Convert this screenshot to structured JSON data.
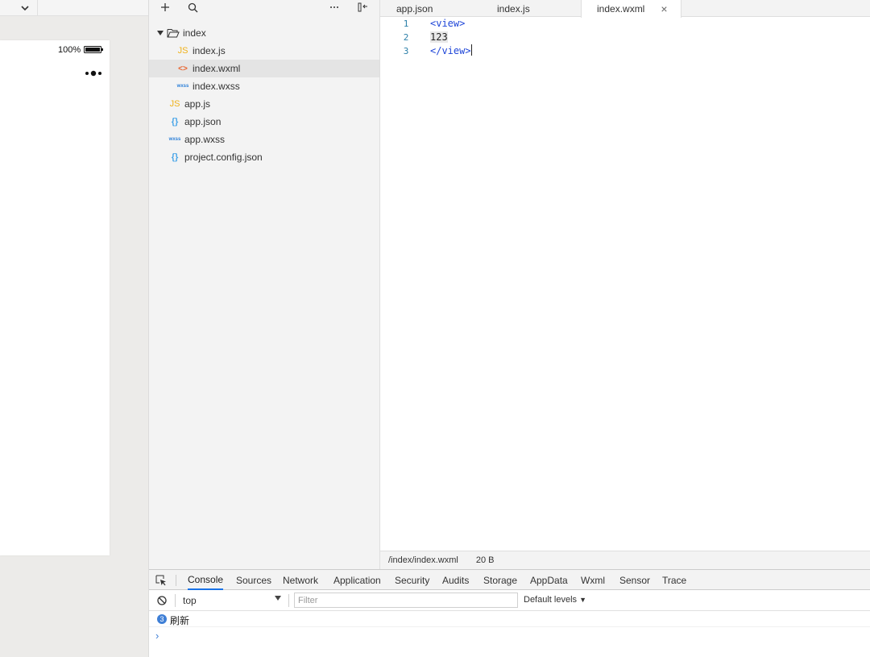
{
  "simulator": {
    "battery_percent": "100%",
    "dropdown_icon": "chevron-down-icon",
    "capsule_icon": "more-dots-icon"
  },
  "toolbar": {
    "add_icon": "plus-icon",
    "search_icon": "search-icon",
    "more_icon": "ellipsis-icon",
    "collapse_icon": "collapse-panel-icon"
  },
  "file_tree": {
    "items": [
      {
        "label": "index",
        "icon": "folder-open-icon",
        "icon_text": "",
        "level": 0
      },
      {
        "label": "index.js",
        "icon": "js-file-icon",
        "icon_text": "JS",
        "level": 1
      },
      {
        "label": "index.wxml",
        "icon": "wxml-file-icon",
        "icon_text": "<>",
        "level": 1
      },
      {
        "label": "index.wxss",
        "icon": "wxss-file-icon",
        "icon_text": "wxss",
        "level": 1
      },
      {
        "label": "app.js",
        "icon": "js-file-icon",
        "icon_text": "JS",
        "level": 0
      },
      {
        "label": "app.json",
        "icon": "json-file-icon",
        "icon_text": "{}",
        "level": 0
      },
      {
        "label": "app.wxss",
        "icon": "wxss-file-icon",
        "icon_text": "wxss",
        "level": 0
      },
      {
        "label": "project.config.json",
        "icon": "json-file-icon",
        "icon_text": "{}",
        "level": 0
      }
    ],
    "selected": "index.wxml"
  },
  "editor": {
    "tabs": [
      {
        "label": "app.json"
      },
      {
        "label": "index.js"
      },
      {
        "label": "index.wxml",
        "closable": true
      }
    ],
    "active_tab": "index.wxml",
    "close_glyph": "×",
    "lines": [
      {
        "number": "1",
        "open": "<view>",
        "text": "",
        "close": ""
      },
      {
        "number": "2",
        "open": "",
        "text": "123",
        "close": ""
      },
      {
        "number": "3",
        "open": "",
        "text": "",
        "close": "</view>"
      }
    ],
    "status_path": "/index/index.wxml",
    "status_size": "20 B"
  },
  "devtools": {
    "tabs": [
      "Console",
      "Sources",
      "Network",
      "Application",
      "Security",
      "Audits",
      "Storage",
      "AppData",
      "Wxml",
      "Sensor",
      "Trace"
    ],
    "active_tab": "Console",
    "context": "top",
    "filter_placeholder": "Filter",
    "levels": "Default levels",
    "message_count": "3",
    "message_text": "刷新",
    "prompt": "›"
  }
}
